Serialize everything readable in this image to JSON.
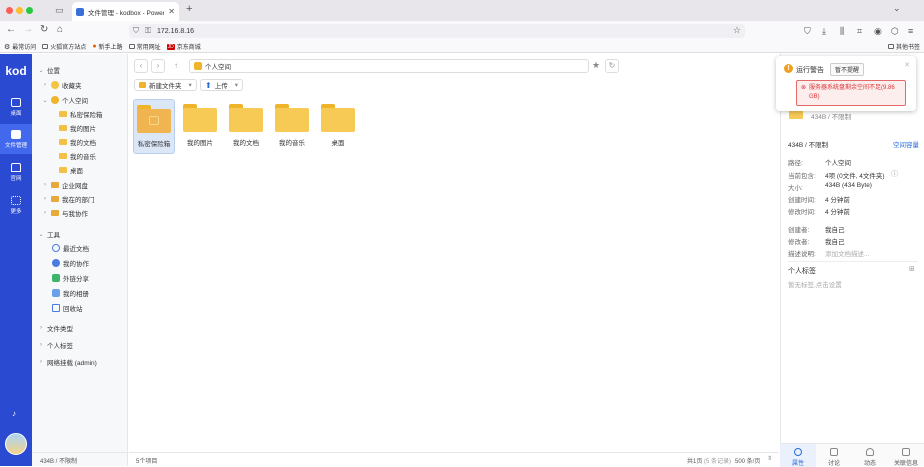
{
  "browser": {
    "tab_title": "文件管理 - kodbox - Powered by",
    "url": "172.16.8.16",
    "bookmarks": [
      "最常访问",
      "火狐官方站点",
      "新手上路",
      "常用网址",
      "京东商城"
    ],
    "other_bookmarks": "其他书签"
  },
  "nav": {
    "logo": "kod",
    "items": [
      {
        "label": "桌面"
      },
      {
        "label": "文件管理"
      },
      {
        "label": "官网"
      },
      {
        "label": "更多"
      }
    ]
  },
  "tree": {
    "section_location": "位置",
    "favorites": "收藏夹",
    "personal_space": "个人空间",
    "children": [
      "私密保险箱",
      "我的图片",
      "我的文档",
      "我的音乐",
      "桌面"
    ],
    "enterprise": "企业网盘",
    "my_dept": "我在的部门",
    "collab_with_me": "与我协作",
    "section_tools": "工具",
    "tools": [
      "最近文档",
      "我的协作",
      "外链分享",
      "我的相册",
      "回收站"
    ],
    "file_types": "文件类型",
    "personal_tags": "个人标签",
    "network_mount": "网络挂载 (admin)",
    "footer": "434B / 不限制"
  },
  "main": {
    "crumb": "个人空间",
    "new_folder": "新建文件夹",
    "upload": "上传",
    "files": [
      "私密保险箱",
      "我的图片",
      "我的文档",
      "我的音乐",
      "桌面"
    ],
    "count": "5个项目",
    "pages": "共1页",
    "pages_hint": "(5 条记录)",
    "page_size": "500 条/页"
  },
  "right": {
    "usage": "434B / 不限制",
    "space_link": "空间容量",
    "path_label": "路径:",
    "path_value": "个人空间",
    "contains_label": "当前包含:",
    "contains_value": "4项 (0文件, 4文件夹)",
    "size_label": "大小:",
    "size_value": "434B (434 Byte)",
    "created_label": "创建时间:",
    "created_value": "4 分钟前",
    "modified_label": "修改时间:",
    "modified_value": "4 分钟前",
    "creator_label": "创建者:",
    "creator_value": "我自己",
    "modifier_label": "修改者:",
    "modifier_value": "我自己",
    "desc_label": "描述说明:",
    "desc_placeholder": "添加文档描述...",
    "tags_title": "个人标签",
    "tags_hint": "暂无标签,点击设置",
    "tabs": [
      "属性",
      "讨论",
      "动态",
      "关联信息"
    ]
  },
  "alert": {
    "title": "运行警告",
    "dismiss": "暂不提醒",
    "message": "服务器系统盘剩余空间不足(9.86 GB)"
  },
  "colors": {
    "nav_blue": "#2a4ad1",
    "folder": "#f7c955",
    "accent": "#2a6bd8",
    "warning": "#f0a020",
    "error": "#d33"
  }
}
